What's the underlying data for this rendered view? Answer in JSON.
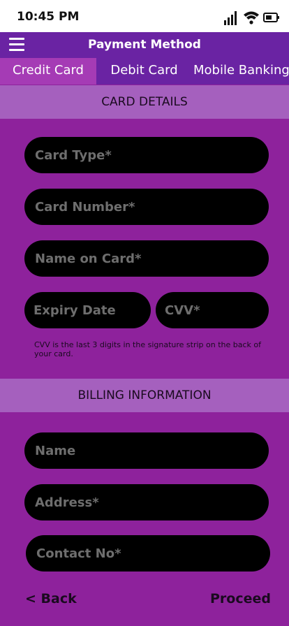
{
  "status_bar": {
    "time": "10:45 PM"
  },
  "app_bar": {
    "title": "Payment Method"
  },
  "tabs": [
    {
      "label": "Credit Card",
      "active": true
    },
    {
      "label": "Debit Card",
      "active": false
    },
    {
      "label": "Mobile Banking",
      "active": false
    }
  ],
  "card_details": {
    "header": "CARD DETAILS",
    "card_type_placeholder": "Card Type*",
    "card_number_placeholder": "Card Number*",
    "name_on_card_placeholder": "Name on Card*",
    "expiry_placeholder": "Expiry Date",
    "cvv_placeholder": "CVV*",
    "cvv_hint": "CVV is the last 3 digits in the signature strip on the back of your card."
  },
  "billing": {
    "header": "BILLING INFORMATION",
    "name_placeholder": "Name",
    "address_placeholder": "Address*",
    "contact_placeholder": "Contact No*"
  },
  "footer": {
    "back_label": "< Back",
    "proceed_label": "Proceed"
  },
  "colors": {
    "background": "#8e229c",
    "app_bar": "#6a23a3",
    "active_tab": "#a53bb5",
    "section_header": "#a560be",
    "input_background": "#000000",
    "placeholder_text": "#6e6e6e"
  },
  "icons": [
    "menu-icon",
    "signal-icon",
    "wifi-icon",
    "battery-icon"
  ]
}
